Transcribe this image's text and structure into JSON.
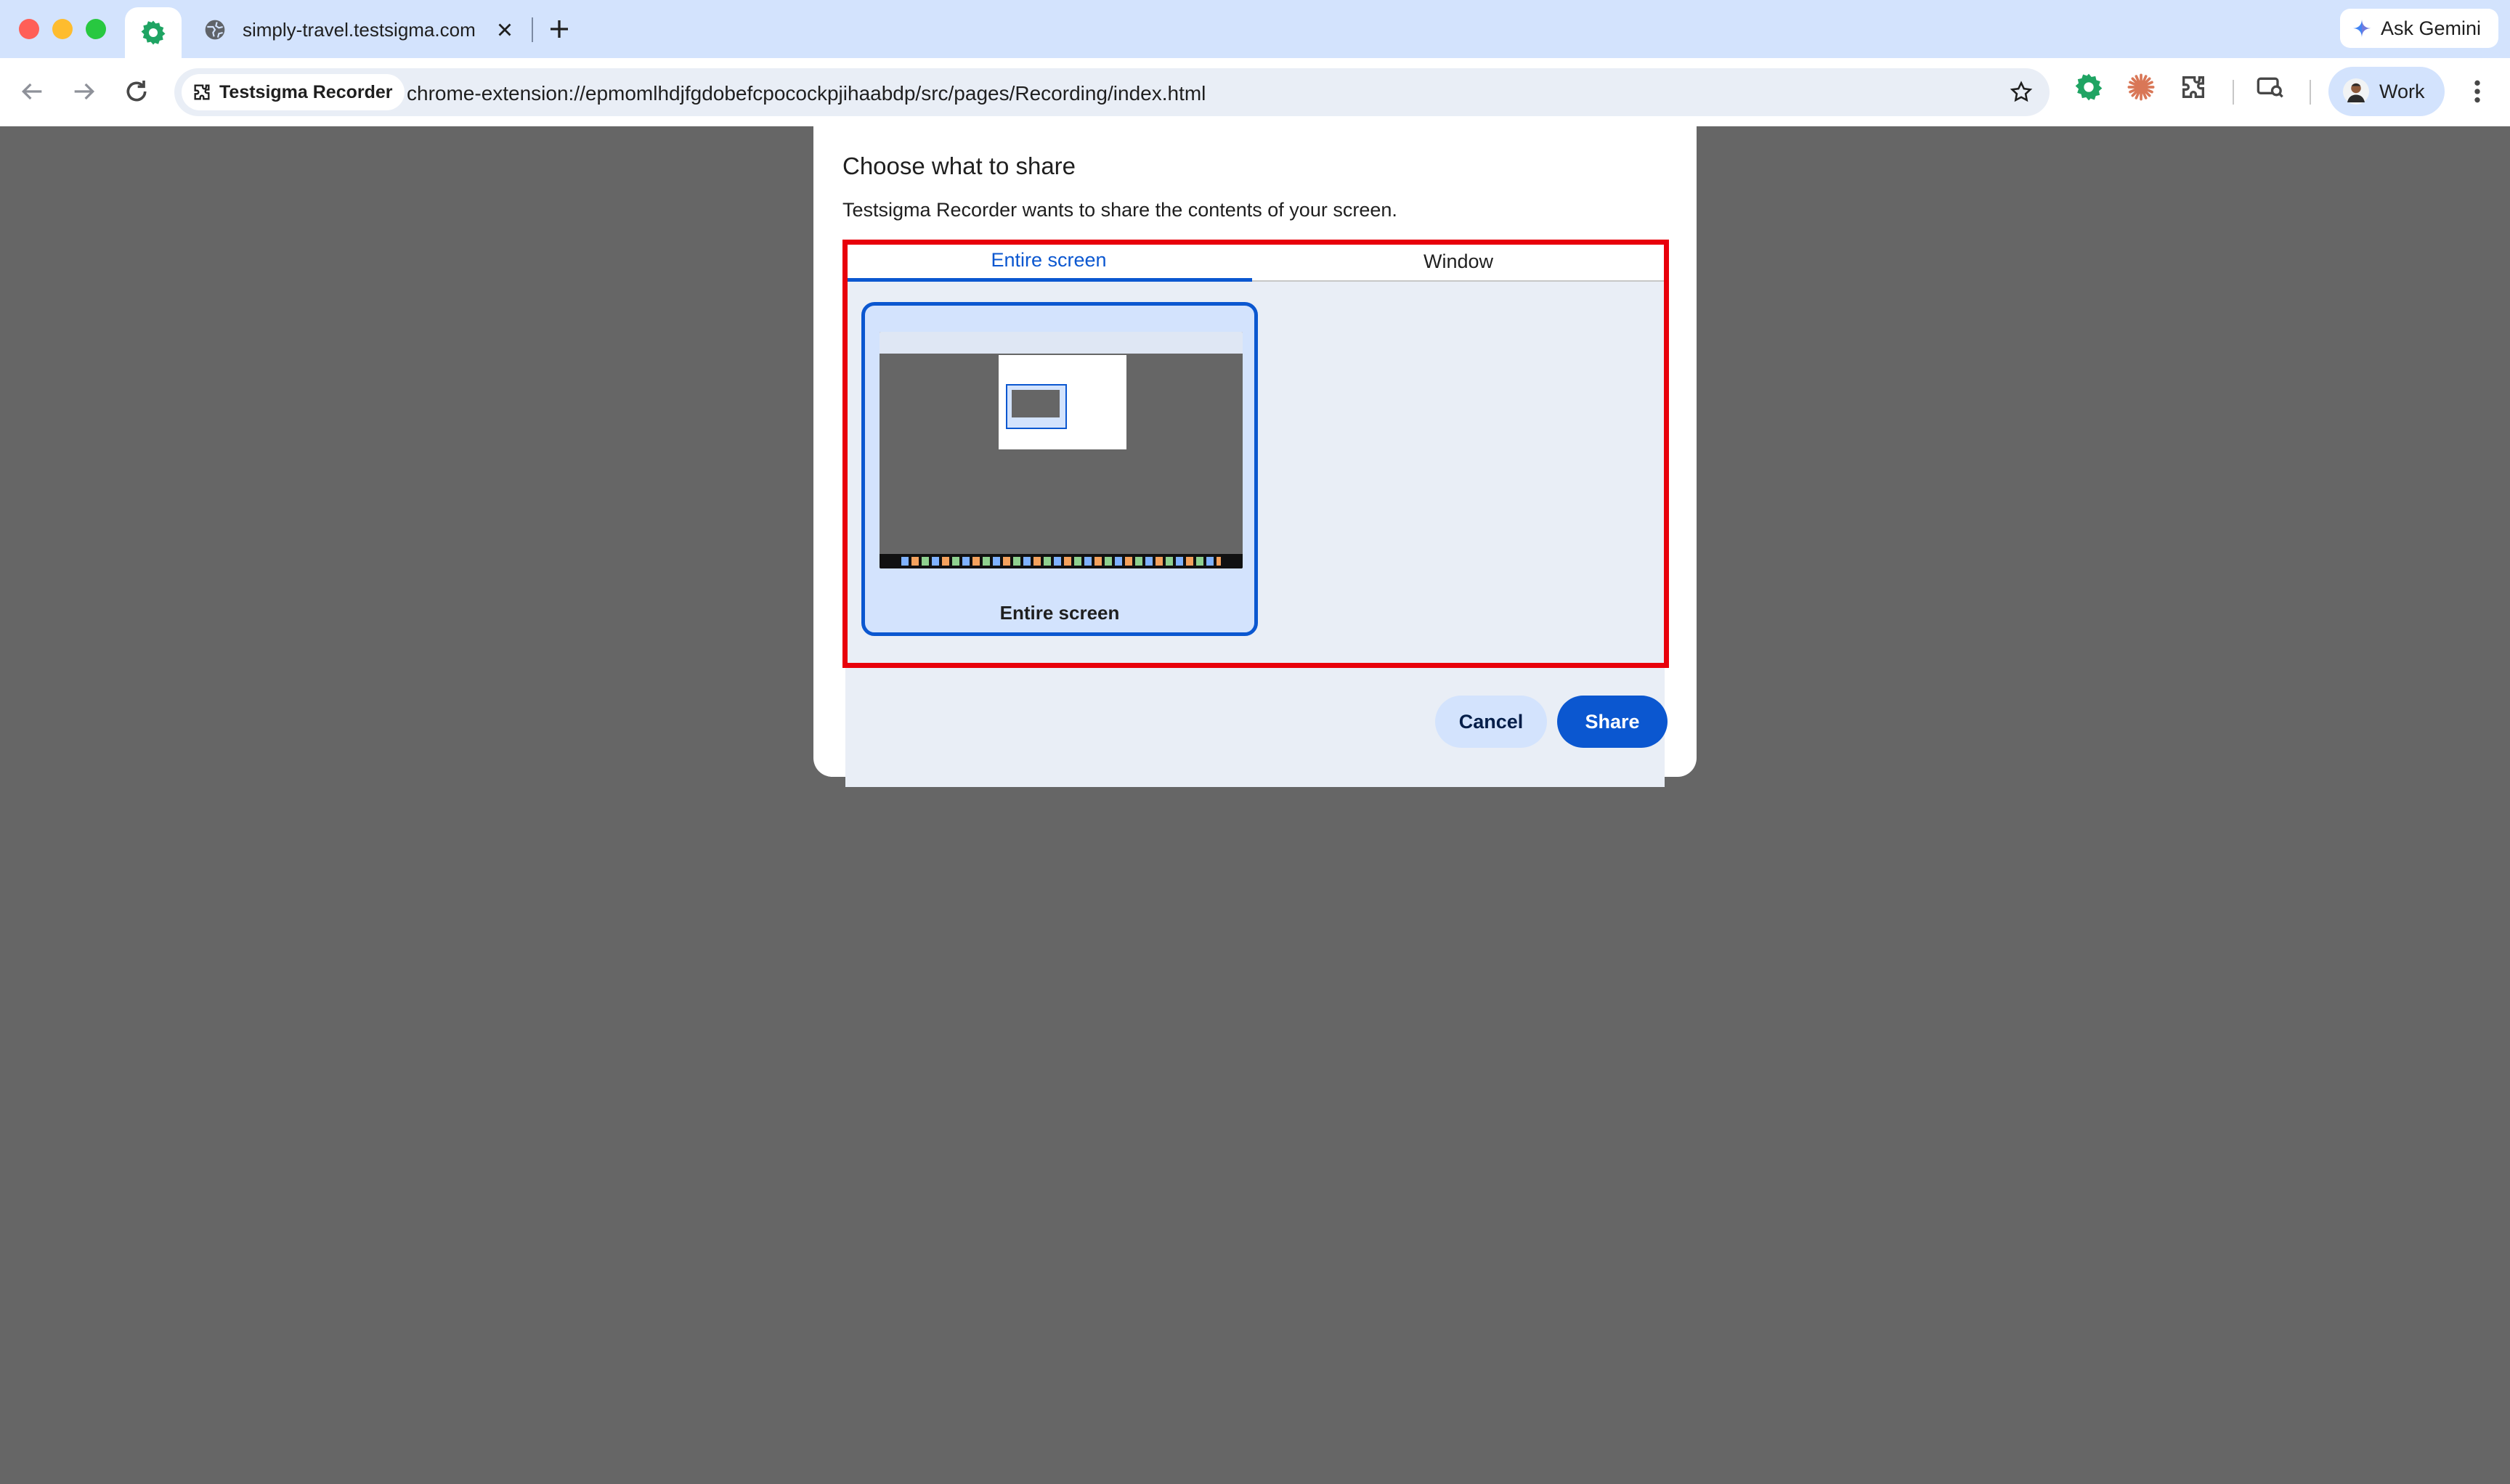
{
  "browser": {
    "tab": {
      "title": "simply-travel.testsigma.com"
    },
    "ask_gemini": "Ask Gemini",
    "site_chip": "Testsigma Recorder",
    "url": "chrome-extension://epmomlhdjfgdobefcpocockpjihaabdp/src/pages/Recording/index.html",
    "profile": "Work"
  },
  "dialog": {
    "title": "Choose what to share",
    "subtitle": "Testsigma Recorder wants to share the contents of your screen.",
    "tabs": [
      {
        "label": "Entire screen",
        "active": true
      },
      {
        "label": "Window",
        "active": false
      }
    ],
    "sources": [
      {
        "label": "Entire screen",
        "selected": true
      }
    ],
    "cancel_label": "Cancel",
    "share_label": "Share"
  },
  "colors": {
    "accent": "#0b57d0",
    "highlight": "#e8000b",
    "tabstrip": "#d3e3fd",
    "backdrop": "#666666"
  }
}
